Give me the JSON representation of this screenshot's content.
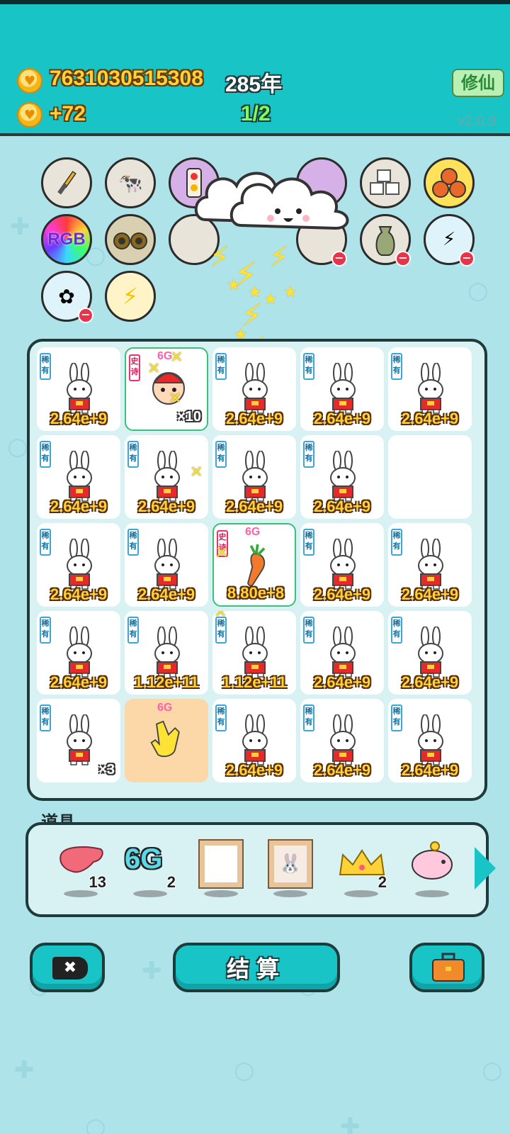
{
  "header": {
    "coins": "7631030515308",
    "years": "285年",
    "income": "+72",
    "progress": "1/2",
    "xiuxian_label": "修仙",
    "version": "v2.0.9"
  },
  "relics": {
    "rgb_label": "RGB"
  },
  "board": {
    "common_tag": "稀有",
    "epic_tag": "史诗",
    "cells": [
      {
        "value": "2.64e+9"
      },
      {
        "count": "×10",
        "badge": "6G"
      },
      {
        "value": "2.64e+9"
      },
      {
        "value": "2.64e+9"
      },
      {
        "value": "2.64e+9"
      },
      {
        "value": "2.64e+9"
      },
      {
        "value": "2.64e+9"
      },
      {
        "value": "2.64e+9"
      },
      {
        "value": "2.64e+9"
      },
      {
        "value": ""
      },
      {
        "value": "2.64e+9"
      },
      {
        "value": "2.64e+9"
      },
      {
        "value": "8.80e+8",
        "badge": "6G"
      },
      {
        "value": "2.64e+9"
      },
      {
        "value": "2.64e+9"
      },
      {
        "value": "2.64e+9"
      },
      {
        "value": "1.12e+11"
      },
      {
        "value": "1.12e+11"
      },
      {
        "value": "2.64e+9"
      },
      {
        "value": "2.64e+9"
      },
      {
        "count": "×3"
      },
      {
        "badge": "6G"
      },
      {
        "value": "2.64e+9"
      },
      {
        "value": "2.64e+9"
      },
      {
        "value": "2.64e+9"
      }
    ]
  },
  "items": {
    "title": "道具",
    "list": [
      {
        "name": "liver",
        "count": "13"
      },
      {
        "name": "6g",
        "label": "6G",
        "count": "2"
      },
      {
        "name": "frame",
        "count": ""
      },
      {
        "name": "poster",
        "count": ""
      },
      {
        "name": "crown",
        "count": "2"
      },
      {
        "name": "piggy",
        "count": ""
      }
    ]
  },
  "footer": {
    "settle_label": "结算"
  }
}
